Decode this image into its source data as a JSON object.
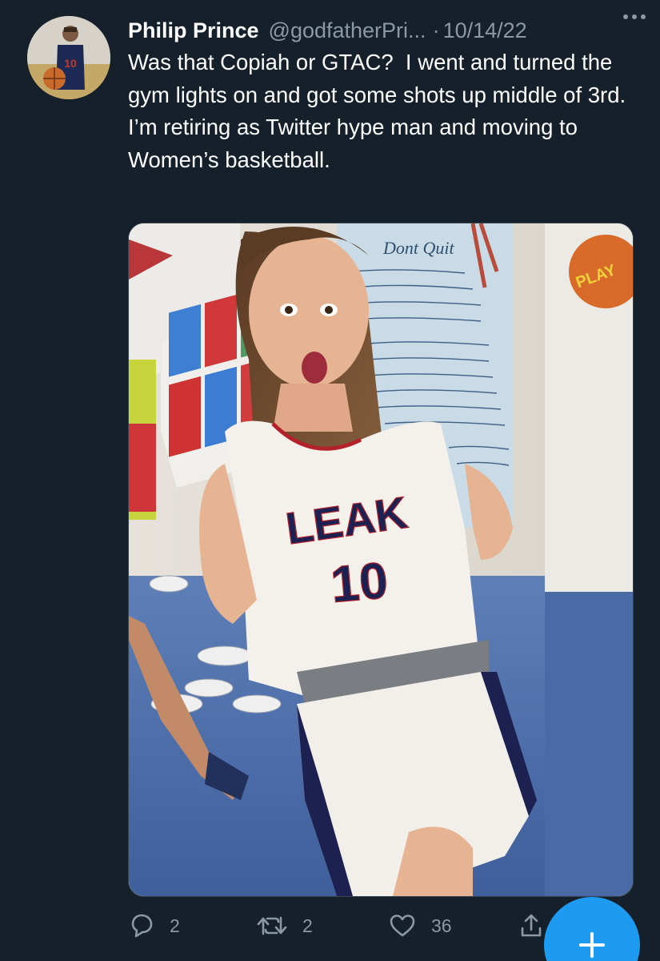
{
  "tweet": {
    "author_name": "Philip Prince",
    "author_handle": "@godfatherPri...",
    "separator": "·",
    "date": "10/14/22",
    "text": "Was that Copiah or GTAC?  I went and turned the gym lights on and got some shots up middle of 3rd.  I’m retiring as Twitter hype man and moving to Women’s basketball.",
    "photo": {
      "poster_title": "Dont Quit",
      "jersey_name": "LEAK",
      "jersey_number": "10",
      "sign_text": "PLAY"
    }
  },
  "actions": {
    "reply_count": "2",
    "retweet_count": "2",
    "like_count": "36"
  },
  "icons": {
    "reply": "reply-icon",
    "retweet": "retweet-icon",
    "like": "heart-icon",
    "share": "share-icon",
    "more": "more-icon",
    "compose": "plus-icon"
  },
  "colors": {
    "background": "#15202b",
    "secondary_text": "#8b98a5",
    "accent": "#1d9bf0",
    "jersey_text": "#1c2152",
    "jersey_trim": "#b3222a"
  }
}
